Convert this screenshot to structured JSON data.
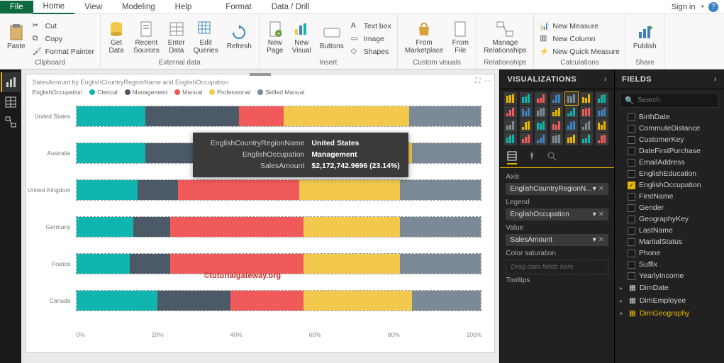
{
  "titlebar": {
    "tabs": [
      "File",
      "Home",
      "View",
      "Modeling",
      "Help",
      "Format",
      "Data / Drill"
    ],
    "signin": "Sign in"
  },
  "ribbon": {
    "clipboard": {
      "label": "Clipboard",
      "paste": "Paste",
      "cut": "Cut",
      "copy": "Copy",
      "painter": "Format Painter"
    },
    "external": {
      "label": "External data",
      "get": "Get\nData",
      "recent": "Recent\nSources",
      "enter": "Enter\nData",
      "edit": "Edit\nQueries",
      "refresh": "Refresh"
    },
    "insert": {
      "label": "Insert",
      "newpage": "New\nPage",
      "newvisual": "New\nVisual",
      "buttons": "Buttons",
      "textbox": "Text box",
      "image": "Image",
      "shapes": "Shapes"
    },
    "custom": {
      "label": "Custom visuals",
      "market": "From\nMarketplace",
      "file": "From\nFile"
    },
    "rel": {
      "label": "Relationships",
      "manage": "Manage\nRelationships"
    },
    "calc": {
      "label": "Calculations",
      "measure": "New Measure",
      "column": "New Column",
      "quick": "New Quick Measure"
    },
    "share": {
      "label": "Share",
      "publish": "Publish"
    }
  },
  "chart_data": {
    "type": "bar",
    "title": "SalesAmount by EnglishCountryRegionName and EnglishOccupation",
    "legend_label": "EnglishOccupation",
    "legend": [
      {
        "name": "Clerical",
        "color": "#0fb5ae"
      },
      {
        "name": "Management",
        "color": "#4c5a67"
      },
      {
        "name": "Manual",
        "color": "#f15a5a"
      },
      {
        "name": "Professional",
        "color": "#f2c94c"
      },
      {
        "name": "Skilled Manual",
        "color": "#7b8a96"
      }
    ],
    "categories": [
      "United States",
      "Australia",
      "United Kingdom",
      "Germany",
      "France",
      "Canada"
    ],
    "series_pct": [
      [
        17,
        23.14,
        11,
        31,
        17.86
      ],
      [
        17,
        21,
        12,
        33,
        17
      ],
      [
        15,
        10,
        30,
        25,
        20
      ],
      [
        14,
        9,
        33,
        24,
        20
      ],
      [
        13,
        10,
        33,
        24,
        20
      ],
      [
        20,
        18,
        18,
        27,
        17
      ]
    ],
    "xticks": [
      "0%",
      "20%",
      "40%",
      "60%",
      "80%",
      "100%"
    ],
    "xlabel": "",
    "ylabel": ""
  },
  "tooltip": {
    "k1": "EnglishCountryRegionName",
    "v1": "United States",
    "k2": "EnglishOccupation",
    "v2": "Management",
    "k3": "SalesAmount",
    "v3": "$2,172,742.9696 (23.14%)"
  },
  "watermark": "©tutorialgateway.org",
  "viz_panel": {
    "title": "VISUALIZATIONS",
    "wells": {
      "axis": {
        "label": "Axis",
        "value": "EnglishCountryRegionN..."
      },
      "legend": {
        "label": "Legend",
        "value": "EnglishOccupation"
      },
      "value": {
        "label": "Value",
        "value": "SalesAmount"
      },
      "colorsat": {
        "label": "Color saturation",
        "placeholder": "Drag data fields here"
      },
      "tooltips": {
        "label": "Tooltips"
      }
    }
  },
  "fields_panel": {
    "title": "FIELDS",
    "search_placeholder": "Search",
    "fields": [
      {
        "name": "BirthDate",
        "checked": false
      },
      {
        "name": "CommuteDistance",
        "checked": false
      },
      {
        "name": "CustomerKey",
        "checked": false
      },
      {
        "name": "DateFirstPurchase",
        "checked": false
      },
      {
        "name": "EmailAddress",
        "checked": false
      },
      {
        "name": "EnglishEducation",
        "checked": false
      },
      {
        "name": "EnglishOccupation",
        "checked": true
      },
      {
        "name": "FirstName",
        "checked": false
      },
      {
        "name": "Gender",
        "checked": false
      },
      {
        "name": "GeographyKey",
        "checked": false
      },
      {
        "name": "LastName",
        "checked": false
      },
      {
        "name": "MaritalStatus",
        "checked": false
      },
      {
        "name": "Phone",
        "checked": false
      },
      {
        "name": "Suffix",
        "checked": false
      },
      {
        "name": "YearlyIncome",
        "checked": false
      }
    ],
    "tables": [
      {
        "name": "DimDate",
        "expanded": false
      },
      {
        "name": "DimEmployee",
        "expanded": false
      },
      {
        "name": "DimGeography",
        "expanded": true
      }
    ]
  }
}
